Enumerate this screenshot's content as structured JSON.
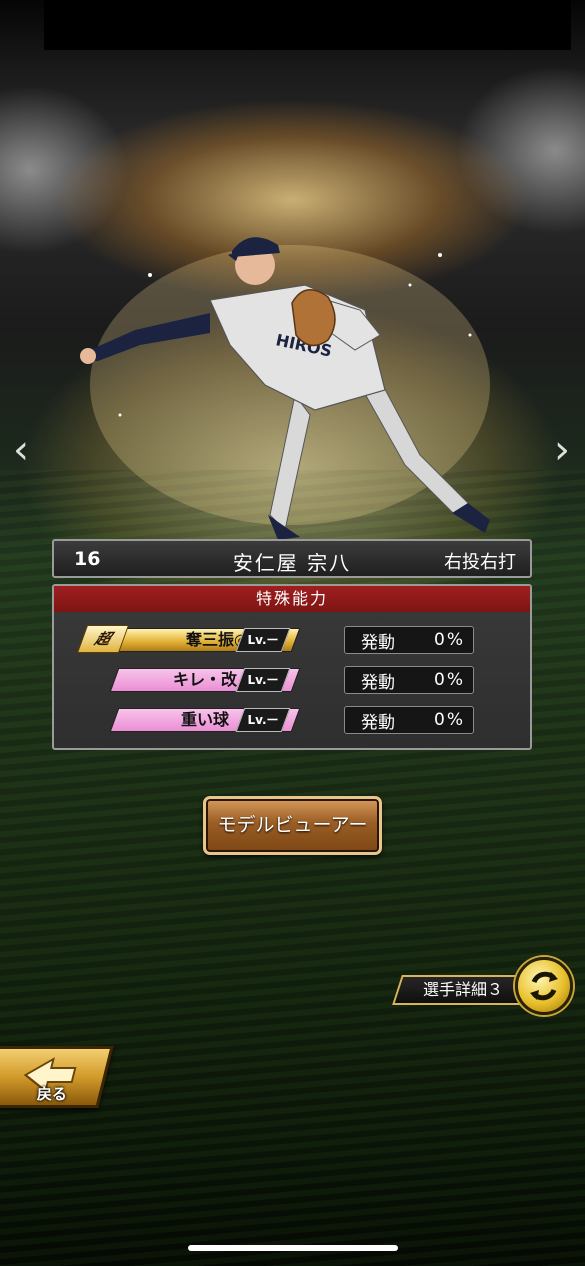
{
  "player": {
    "number": "16",
    "name": "安仁屋 宗八",
    "handedness": "右投右打"
  },
  "abilities": {
    "header": "特殊能力",
    "items": [
      {
        "name": "奪三振◎",
        "badge": "超",
        "tier": "gold",
        "level": "Lv.ー",
        "activation_label": "発動",
        "activation_value": "0%"
      },
      {
        "name": "キレ・改",
        "badge": "",
        "tier": "pink",
        "level": "Lv.ー",
        "activation_label": "発動",
        "activation_value": "0%"
      },
      {
        "name": "重い球",
        "badge": "",
        "tier": "pink",
        "level": "Lv.ー",
        "activation_label": "発動",
        "activation_value": "0%"
      }
    ]
  },
  "buttons": {
    "model_viewer": "モデルビューアー",
    "player_detail": "選手詳細３",
    "back": "戻る"
  },
  "icons": {
    "prev": "chevron-left-icon",
    "next": "chevron-right-icon",
    "cycle": "cycle-arrows-icon",
    "back": "back-arrow-icon"
  },
  "colors": {
    "ability_header": "#8e1a1a",
    "gold_skill": "#e4b43a",
    "pink_skill": "#ea8fd4",
    "button_bronze": "#9a5e25"
  }
}
